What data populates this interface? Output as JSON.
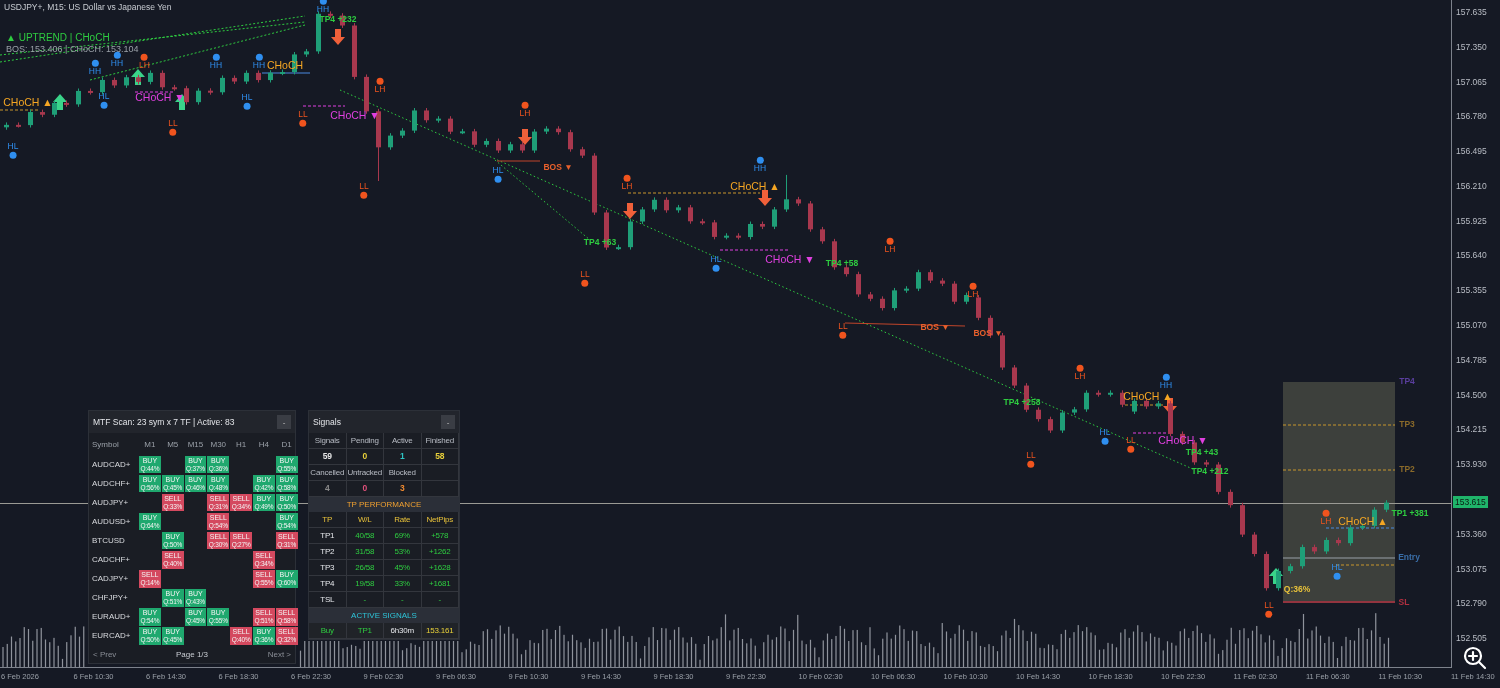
{
  "chart": {
    "title": "USDJPY+, M15:  US Dollar vs Japanese Yen",
    "trend": "▲ UPTREND | CHoCH",
    "levels": "BOS: 153.406  |  CHoCH: 153.104",
    "chart_data": {
      "type": "candlestick",
      "categories": [
        null,
        null,
        null,
        null,
        null,
        null,
        null,
        null,
        null,
        null,
        null,
        null,
        null,
        null,
        null,
        null,
        null,
        null,
        null,
        null,
        null,
        null,
        null,
        null,
        null,
        null,
        null,
        null,
        null,
        null,
        null,
        null,
        null,
        null,
        null,
        null,
        null,
        null,
        null,
        null,
        null,
        null,
        null,
        null,
        null,
        null,
        null,
        null,
        null,
        null,
        null,
        null,
        null,
        null,
        null,
        null,
        null,
        null,
        null,
        null,
        null,
        null,
        null,
        null,
        null,
        null,
        null,
        null,
        null,
        null,
        null,
        null,
        null,
        null,
        null,
        null,
        null,
        null,
        null,
        null,
        null,
        null,
        null,
        null,
        null,
        null,
        null,
        null,
        null,
        null,
        null,
        null,
        null,
        null,
        null,
        null,
        null,
        null,
        null,
        null,
        null,
        null,
        null,
        null,
        null,
        null,
        null,
        null,
        null,
        null,
        null,
        null,
        null,
        null,
        null,
        null,
        null,
        null,
        null,
        null,
        null
      ],
      "ylim": [
        152.26,
        157.733
      ],
      "ref_lines": [
        {
          "axis": "y",
          "value": 153.615
        }
      ],
      "yticks": [
        {
          "value": 157.635,
          "label": "157.635"
        },
        {
          "value": 157.35,
          "label": "157.350"
        },
        {
          "value": 157.065,
          "label": "157.065"
        },
        {
          "value": 156.78,
          "label": "156.780"
        },
        {
          "value": 156.495,
          "label": "156.495"
        },
        {
          "value": 156.21,
          "label": "156.210"
        },
        {
          "value": 155.925,
          "label": "155.925"
        },
        {
          "value": 155.64,
          "label": "155.640"
        },
        {
          "value": 155.355,
          "label": "155.355"
        },
        {
          "value": 155.07,
          "label": "155.070"
        },
        {
          "value": 154.785,
          "label": "154.785"
        },
        {
          "value": 154.5,
          "label": "154.500"
        },
        {
          "value": 154.215,
          "label": "154.215"
        },
        {
          "value": 153.93,
          "label": "153.930"
        },
        {
          "value": 153.36,
          "label": "153.360"
        },
        {
          "value": 153.075,
          "label": "153.075"
        },
        {
          "value": 152.79,
          "label": "152.790"
        },
        {
          "value": 152.505,
          "label": "152.505"
        }
      ],
      "ohlc": [
        [
          156.69,
          156.73,
          156.67,
          156.71
        ],
        [
          156.71,
          156.73,
          156.688,
          156.708
        ],
        [
          156.708,
          156.835,
          156.688,
          156.815
        ],
        [
          156.815,
          156.835,
          156.773,
          156.793
        ],
        [
          156.793,
          156.91,
          156.773,
          156.89
        ],
        [
          156.89,
          156.91,
          156.858,
          156.878
        ],
        [
          156.878,
          157.008,
          156.858,
          156.988
        ],
        [
          156.988,
          157.008,
          156.958,
          156.978
        ],
        [
          156.978,
          157.098,
          156.958,
          157.078
        ],
        [
          157.078,
          157.098,
          157.013,
          157.033
        ],
        [
          157.033,
          157.12,
          157.013,
          157.1
        ],
        [
          157.1,
          157.12,
          157.042,
          157.062
        ],
        [
          157.062,
          157.156,
          157.042,
          157.136
        ],
        [
          157.136,
          157.156,
          156.998,
          157.018
        ],
        [
          157.018,
          157.038,
          156.99,
          157.01
        ],
        [
          157.01,
          157.03,
          156.876,
          156.896
        ],
        [
          156.896,
          157.01,
          156.876,
          156.99
        ],
        [
          156.99,
          157.01,
          156.957,
          156.977
        ],
        [
          156.977,
          157.115,
          156.957,
          157.095
        ],
        [
          157.095,
          157.115,
          157.045,
          157.065
        ],
        [
          157.065,
          157.156,
          157.045,
          157.136
        ],
        [
          157.136,
          157.156,
          157.057,
          157.077
        ],
        [
          157.077,
          157.157,
          157.057,
          157.137
        ],
        [
          157.137,
          157.163,
          157.117,
          157.143
        ],
        [
          157.143,
          157.307,
          157.123,
          157.287
        ],
        [
          157.287,
          157.332,
          157.267,
          157.312
        ],
        [
          157.312,
          157.64,
          157.292,
          157.62
        ],
        [
          157.62,
          157.64,
          157.585,
          157.605
        ],
        [
          157.605,
          157.625,
          157.504,
          157.524
        ],
        [
          157.524,
          157.544,
          157.083,
          157.103
        ],
        [
          157.103,
          157.123,
          156.801,
          156.821
        ],
        [
          156.821,
          156.841,
          156.25,
          156.526
        ],
        [
          156.526,
          156.642,
          156.506,
          156.622
        ],
        [
          156.622,
          156.683,
          156.602,
          156.663
        ],
        [
          156.663,
          156.848,
          156.643,
          156.828
        ],
        [
          156.828,
          156.848,
          156.728,
          156.748
        ],
        [
          156.748,
          156.781,
          156.728,
          156.761
        ],
        [
          156.761,
          156.781,
          156.634,
          156.654
        ],
        [
          156.654,
          156.677,
          156.634,
          156.657
        ],
        [
          156.657,
          156.677,
          156.527,
          156.547
        ],
        [
          156.547,
          156.598,
          156.527,
          156.578
        ],
        [
          156.578,
          156.598,
          156.48,
          156.5
        ],
        [
          156.5,
          156.571,
          156.48,
          156.551
        ],
        [
          156.551,
          156.571,
          156.48,
          156.5
        ],
        [
          156.5,
          156.675,
          156.48,
          156.655
        ],
        [
          156.655,
          156.699,
          156.635,
          156.679
        ],
        [
          156.679,
          156.699,
          156.63,
          156.65
        ],
        [
          156.65,
          156.67,
          156.49,
          156.51
        ],
        [
          156.51,
          156.53,
          156.438,
          156.458
        ],
        [
          156.458,
          156.478,
          155.972,
          155.992
        ],
        [
          155.992,
          156.012,
          155.685,
          155.705
        ],
        [
          155.705,
          155.728,
          155.685,
          155.708
        ],
        [
          155.708,
          155.938,
          155.688,
          155.918
        ],
        [
          155.918,
          156.037,
          155.898,
          156.017
        ],
        [
          156.017,
          156.116,
          155.997,
          156.096
        ],
        [
          156.096,
          156.116,
          155.99,
          156.01
        ],
        [
          156.01,
          156.054,
          155.99,
          156.034
        ],
        [
          156.034,
          156.054,
          155.9,
          155.92
        ],
        [
          155.92,
          155.94,
          155.891,
          155.911
        ],
        [
          155.911,
          155.931,
          155.772,
          155.792
        ],
        [
          155.792,
          155.822,
          155.772,
          155.802
        ],
        [
          155.802,
          155.822,
          155.771,
          155.791
        ],
        [
          155.791,
          155.918,
          155.771,
          155.898
        ],
        [
          155.898,
          155.918,
          155.856,
          155.876
        ],
        [
          155.876,
          156.037,
          155.856,
          156.017
        ],
        [
          156.017,
          156.3,
          155.997,
          156.1
        ],
        [
          156.1,
          156.12,
          156.046,
          156.066
        ],
        [
          156.066,
          156.086,
          155.834,
          155.854
        ],
        [
          155.854,
          155.874,
          155.736,
          155.756
        ],
        [
          155.756,
          155.776,
          155.523,
          155.543
        ],
        [
          155.543,
          155.563,
          155.467,
          155.487
        ],
        [
          155.487,
          155.507,
          155.301,
          155.321
        ],
        [
          155.321,
          155.341,
          155.265,
          155.285
        ],
        [
          155.285,
          155.305,
          155.189,
          155.209
        ],
        [
          155.209,
          155.374,
          155.189,
          155.354
        ],
        [
          155.354,
          155.388,
          155.334,
          155.368
        ],
        [
          155.368,
          155.523,
          155.348,
          155.503
        ],
        [
          155.503,
          155.523,
          155.414,
          155.434
        ],
        [
          155.434,
          155.454,
          155.389,
          155.409
        ],
        [
          155.409,
          155.429,
          155.241,
          155.261
        ],
        [
          155.261,
          155.336,
          155.241,
          155.316
        ],
        [
          155.296,
          155.316,
          155.109,
          155.129
        ],
        [
          155.129,
          155.149,
          154.965,
          154.985
        ],
        [
          154.985,
          155.005,
          154.702,
          154.722
        ],
        [
          154.722,
          154.742,
          154.554,
          154.574
        ],
        [
          154.574,
          154.594,
          154.356,
          154.376
        ],
        [
          154.376,
          154.396,
          154.279,
          154.299
        ],
        [
          154.299,
          154.319,
          154.186,
          154.206
        ],
        [
          154.206,
          154.373,
          154.186,
          154.353
        ],
        [
          154.353,
          154.399,
          154.333,
          154.379
        ],
        [
          154.379,
          154.535,
          154.359,
          154.515
        ],
        [
          154.515,
          154.535,
          154.483,
          154.503
        ],
        [
          154.503,
          154.535,
          154.483,
          154.515
        ],
        [
          154.515,
          154.535,
          154.397,
          154.417
        ],
        [
          154.361,
          154.469,
          154.341,
          154.449
        ],
        [
          154.449,
          154.469,
          154.383,
          154.403
        ],
        [
          154.403,
          154.448,
          154.383,
          154.428
        ],
        [
          154.428,
          154.448,
          154.158,
          154.178
        ],
        [
          154.178,
          154.198,
          154.088,
          154.108
        ],
        [
          154.108,
          154.128,
          153.925,
          153.945
        ],
        [
          153.945,
          153.965,
          153.907,
          153.927
        ],
        [
          153.927,
          153.947,
          153.683,
          153.703
        ],
        [
          153.703,
          153.723,
          153.574,
          153.594
        ],
        [
          153.594,
          153.614,
          153.333,
          153.353
        ],
        [
          153.353,
          153.373,
          153.174,
          153.194
        ],
        [
          153.194,
          153.214,
          152.894,
          152.914
        ],
        [
          152.914,
          153.075,
          152.894,
          153.055
        ],
        [
          153.055,
          153.114,
          153.035,
          153.094
        ],
        [
          153.094,
          153.271,
          153.074,
          153.251
        ],
        [
          153.251,
          153.271,
          153.195,
          153.215
        ],
        [
          153.215,
          153.329,
          153.195,
          153.309
        ],
        [
          153.309,
          153.329,
          153.263,
          153.283
        ],
        [
          153.283,
          153.431,
          153.263,
          153.411
        ],
        [
          153.411,
          153.444,
          153.391,
          153.424
        ],
        [
          153.424,
          153.577,
          153.404,
          153.557
        ],
        [
          153.557,
          153.635,
          153.537,
          153.615
        ],
        null,
        null,
        null,
        null,
        null
      ]
    }
  },
  "chart_labels": [
    {
      "text": "HH",
      "kind": "swing_high",
      "color": "#2f8ff0"
    },
    {
      "text": "HH",
      "kind": "swing_high",
      "color": "#2f8ff0"
    },
    {
      "text": "LH",
      "kind": "swing_high",
      "color": "#f0541e"
    },
    {
      "text": "HH",
      "kind": "swing_high",
      "color": "#2f8ff0"
    },
    {
      "text": "HH",
      "kind": "swing_high",
      "color": "#2f8ff0"
    },
    {
      "text": "HH",
      "kind": "swing_high",
      "color": "#2f8ff0"
    },
    {
      "text": "LH",
      "kind": "swing_high",
      "color": "#f0541e"
    },
    {
      "text": "LH",
      "kind": "swing_high",
      "color": "#f0541e"
    },
    {
      "text": "LH",
      "kind": "swing_high",
      "color": "#f0541e"
    },
    {
      "text": "HH",
      "kind": "swing_high",
      "color": "#2f8ff0"
    },
    {
      "text": "LH",
      "kind": "swing_high",
      "color": "#f0541e"
    },
    {
      "text": "LH",
      "kind": "swing_high",
      "color": "#f0541e"
    },
    {
      "text": "LH",
      "kind": "swing_high",
      "color": "#f0541e"
    },
    {
      "text": "HH",
      "kind": "swing_high",
      "color": "#2f8ff0"
    },
    {
      "text": "LH",
      "kind": "swing_high",
      "color": "#f0541e"
    },
    {
      "text": "HL",
      "kind": "swing_low",
      "color": "#2f8ff0"
    },
    {
      "text": "HL",
      "kind": "swing_low",
      "color": "#2f8ff0"
    },
    {
      "text": "HL",
      "kind": "swing_low",
      "color": "#2f8ff0"
    },
    {
      "text": "HL",
      "kind": "swing_low",
      "color": "#2f8ff0"
    },
    {
      "text": "HL",
      "kind": "swing_low",
      "color": "#2f8ff0"
    },
    {
      "text": "HL",
      "kind": "swing_low",
      "color": "#2f8ff0"
    },
    {
      "text": "HL",
      "kind": "swing_low",
      "color": "#2f8ff0"
    },
    {
      "text": "LL",
      "kind": "swing_low",
      "color": "#f0541e"
    },
    {
      "text": "LL",
      "kind": "swing_low",
      "color": "#f0541e"
    },
    {
      "text": "LL",
      "kind": "swing_low",
      "color": "#f0541e"
    },
    {
      "text": "LL",
      "kind": "swing_low",
      "color": "#f0541e"
    },
    {
      "text": "LL",
      "kind": "swing_low",
      "color": "#f0541e"
    },
    {
      "text": "LL",
      "kind": "swing_low",
      "color": "#f0541e"
    },
    {
      "text": "LL",
      "kind": "swing_low",
      "color": "#f0541e"
    },
    {
      "text": "LL",
      "kind": "swing_low",
      "color": "#f0541e"
    },
    {
      "text": "CHoCH ▲",
      "kind": "structure",
      "color": "#f5a623"
    },
    {
      "text": "CHoCH ▼",
      "kind": "structure",
      "color": "#e040e0"
    },
    {
      "text": "CHoCH",
      "kind": "structure",
      "color": "#f5a623"
    },
    {
      "text": "CHoCH ▼",
      "kind": "structure",
      "color": "#e040e0"
    },
    {
      "text": "CHoCH ▲",
      "kind": "structure",
      "color": "#f5a623"
    },
    {
      "text": "CHoCH ▼",
      "kind": "structure",
      "color": "#e040e0"
    },
    {
      "text": "CHoCH ▲",
      "kind": "structure",
      "color": "#f5a623"
    },
    {
      "text": "CHoCH ▼",
      "kind": "structure",
      "color": "#e040e0"
    },
    {
      "text": "CHoCH ▲",
      "kind": "structure",
      "color": "#f5a623"
    },
    {
      "text": "BOS ▼",
      "kind": "bos",
      "color": "#e8602c"
    },
    {
      "text": "BOS ▼",
      "kind": "bos",
      "color": "#e8602c"
    },
    {
      "text": "BOS ▼",
      "kind": "bos",
      "color": "#e8602c"
    },
    {
      "text": "TP4 +232",
      "kind": "target",
      "color": "#2ecc40"
    },
    {
      "text": "TP4 +63",
      "kind": "target",
      "color": "#2ecc40"
    },
    {
      "text": "TP4 +58",
      "kind": "target",
      "color": "#2ecc40"
    },
    {
      "text": "TP4 +258",
      "kind": "target",
      "color": "#2ecc40"
    },
    {
      "text": "TP4 +43",
      "kind": "target",
      "color": "#2ecc40"
    },
    {
      "text": "TP4 +212",
      "kind": "target",
      "color": "#2ecc40"
    },
    {
      "text": "TP1 +381",
      "kind": "target",
      "color": "#2ecc40"
    },
    {
      "text": "Q:36%",
      "kind": "target",
      "color": "#e8c23a"
    },
    {
      "text": "TP4",
      "kind": "level",
      "color": "#5a3e9e"
    },
    {
      "text": "TP3",
      "kind": "level",
      "color": "#8a6a2a"
    },
    {
      "text": "TP2",
      "kind": "level",
      "color": "#8a6a2a"
    },
    {
      "text": "Entry",
      "kind": "level",
      "color": "#3a6ea8"
    },
    {
      "text": "SL",
      "kind": "level",
      "color": "#b03040"
    }
  ],
  "current_price": "153.615",
  "time_axis": [
    "6 Feb 2026",
    "6 Feb 10:30",
    "6 Feb 14:30",
    "6 Feb 18:30",
    "6 Feb 22:30",
    "9 Feb 02:30",
    "9 Feb 06:30",
    "9 Feb 10:30",
    "9 Feb 14:30",
    "9 Feb 18:30",
    "9 Feb 22:30",
    "10 Feb 02:30",
    "10 Feb 06:30",
    "10 Feb 10:30",
    "10 Feb 14:30",
    "10 Feb 18:30",
    "10 Feb 22:30",
    "11 Feb 02:30",
    "11 Feb 06:30",
    "11 Feb 10:30",
    "11 Feb 14:30"
  ],
  "mtf_panel": {
    "title": "MTF Scan: 23 sym x 7 TF | Active: 83",
    "collapse": "-",
    "columns": [
      "Symbol",
      "M1",
      "M5",
      "M15",
      "M30",
      "H1",
      "H4",
      "D1"
    ],
    "rows": [
      {
        "cells": [
          "AUDCAD+",
          {
            "kind": "buy",
            "signal": "BUY",
            "quality": "Q:44%"
          },
          "",
          {
            "kind": "buy",
            "signal": "BUY",
            "quality": "Q:37%"
          },
          {
            "kind": "buy",
            "signal": "BUY",
            "quality": "Q:36%"
          },
          "",
          "",
          {
            "kind": "buy",
            "signal": "BUY",
            "quality": "Q:55%"
          }
        ]
      },
      {
        "cells": [
          "AUDCHF+",
          {
            "kind": "buy",
            "signal": "BUY",
            "quality": "Q:56%"
          },
          {
            "kind": "buy",
            "signal": "BUY",
            "quality": "Q:45%"
          },
          {
            "kind": "buy",
            "signal": "BUY",
            "quality": "Q:46%"
          },
          {
            "kind": "buy",
            "signal": "BUY",
            "quality": "Q:48%"
          },
          "",
          {
            "kind": "buy",
            "signal": "BUY",
            "quality": "Q:42%"
          },
          {
            "kind": "buy",
            "signal": "BUY",
            "quality": "Q:58%"
          }
        ]
      },
      {
        "cells": [
          "AUDJPY+",
          "",
          {
            "kind": "sell",
            "signal": "SELL",
            "quality": "Q:33%"
          },
          "",
          {
            "kind": "sell",
            "signal": "SELL",
            "quality": "Q:31%"
          },
          {
            "kind": "sell",
            "signal": "SELL",
            "quality": "Q:34%"
          },
          {
            "kind": "buy",
            "signal": "BUY",
            "quality": "Q:49%"
          },
          {
            "kind": "buy",
            "signal": "BUY",
            "quality": "Q:50%"
          }
        ]
      },
      {
        "cells": [
          "AUDUSD+",
          {
            "kind": "buy",
            "signal": "BUY",
            "quality": "Q:64%"
          },
          "",
          "",
          {
            "kind": "sell",
            "signal": "SELL",
            "quality": "Q:54%"
          },
          "",
          "",
          {
            "kind": "buy",
            "signal": "BUY",
            "quality": "Q:54%"
          }
        ]
      },
      {
        "cells": [
          "BTCUSD",
          "",
          {
            "kind": "buy",
            "signal": "BUY",
            "quality": "Q:50%"
          },
          "",
          {
            "kind": "sell",
            "signal": "SELL",
            "quality": "Q:30%"
          },
          {
            "kind": "sell",
            "signal": "SELL",
            "quality": "Q:27%"
          },
          "",
          {
            "kind": "sell",
            "signal": "SELL",
            "quality": "Q:31%"
          }
        ]
      },
      {
        "cells": [
          "CADCHF+",
          "",
          {
            "kind": "sell",
            "signal": "SELL",
            "quality": "Q:40%"
          },
          "",
          "",
          "",
          {
            "kind": "sell",
            "signal": "SELL",
            "quality": "Q:34%"
          },
          ""
        ]
      },
      {
        "cells": [
          "CADJPY+",
          {
            "kind": "sell",
            "signal": "SELL",
            "quality": "Q:14%"
          },
          "",
          "",
          "",
          "",
          {
            "kind": "sell",
            "signal": "SELL",
            "quality": "Q:55%"
          },
          {
            "kind": "buy",
            "signal": "BUY",
            "quality": "Q:60%"
          }
        ]
      },
      {
        "cells": [
          "CHFJPY+",
          "",
          {
            "kind": "buy",
            "signal": "BUY",
            "quality": "Q:51%"
          },
          {
            "kind": "buy",
            "signal": "BUY",
            "quality": "Q:43%"
          },
          "",
          "",
          "",
          ""
        ]
      },
      {
        "cells": [
          "EURAUD+",
          {
            "kind": "buy",
            "signal": "BUY",
            "quality": "Q:54%"
          },
          "",
          {
            "kind": "buy",
            "signal": "BUY",
            "quality": "Q:45%"
          },
          {
            "kind": "buy",
            "signal": "BUY",
            "quality": "Q:55%"
          },
          "",
          {
            "kind": "sell",
            "signal": "SELL",
            "quality": "Q:51%"
          },
          {
            "kind": "sell",
            "signal": "SELL",
            "quality": "Q:58%"
          }
        ]
      },
      {
        "cells": [
          "EURCAD+",
          {
            "kind": "buy",
            "signal": "BUY",
            "quality": "Q:50%"
          },
          {
            "kind": "buy",
            "signal": "BUY",
            "quality": "Q:45%"
          },
          "",
          "",
          {
            "kind": "sell",
            "signal": "SELL",
            "quality": "Q:40%"
          },
          {
            "kind": "buy",
            "signal": "BUY",
            "quality": "Q:36%"
          },
          {
            "kind": "sell",
            "signal": "SELL",
            "quality": "Q:32%"
          }
        ]
      }
    ],
    "prev": "< Prev",
    "page": "Page 1/3",
    "next": "Next >"
  },
  "signals_panel": {
    "title": "Signals",
    "collapse": "-",
    "stats": [
      {
        "label": "Signals",
        "value": "59",
        "color": "#e6e6e6"
      },
      {
        "label": "Pending",
        "value": "0",
        "color": "#e8d03a"
      },
      {
        "label": "Active",
        "value": "1",
        "color": "#2ec4c4"
      },
      {
        "label": "Finished",
        "value": "58",
        "color": "#e8d03a"
      },
      {
        "label": "Cancelled",
        "value": "4",
        "color": "#8a8a8a"
      },
      {
        "label": "Untracked",
        "value": "0",
        "color": "#e0507a"
      },
      {
        "label": "Blocked",
        "value": "3",
        "color": "#f08a30"
      }
    ],
    "performance_title": "TP PERFORMANCE",
    "performance_columns": [
      "TP",
      "W/L",
      "Rate",
      "NetPips"
    ],
    "performance_rows": [
      [
        "TP1",
        "40/58",
        "69%",
        "+578"
      ],
      [
        "TP2",
        "31/58",
        "53%",
        "+1262"
      ],
      [
        "TP3",
        "26/58",
        "45%",
        "+1628"
      ],
      [
        "TP4",
        "19/58",
        "33%",
        "+1681"
      ],
      [
        "TSL",
        "-",
        "-",
        "-"
      ]
    ],
    "active_title": "ACTIVE SIGNALS",
    "active_row": [
      "Buy",
      "TP1",
      "6h30m",
      "153.161"
    ]
  }
}
